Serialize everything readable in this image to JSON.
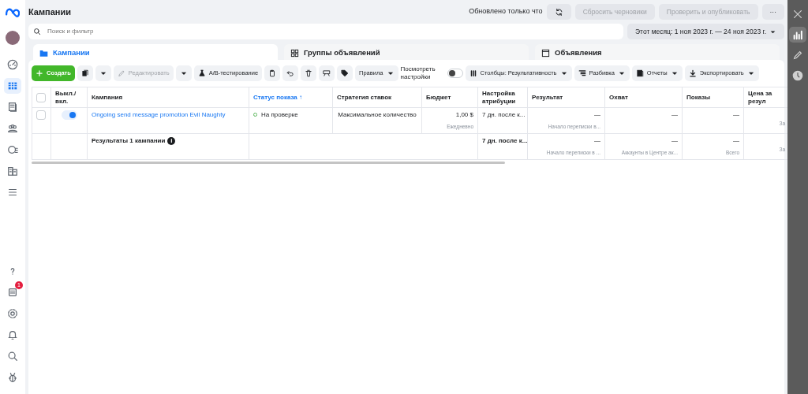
{
  "left_rail": {
    "top": [
      {
        "selected": false
      },
      {
        "selected": true
      },
      {
        "selected": false
      },
      {
        "selected": false
      },
      {
        "selected": false
      },
      {
        "selected": false
      },
      {
        "selected": false
      }
    ],
    "bottom": [
      {
        "selected": false
      },
      {
        "selected": false,
        "badge": "1"
      },
      {
        "selected": false
      },
      {
        "selected": false
      },
      {
        "selected": false
      },
      {
        "selected": false
      }
    ]
  },
  "header": {
    "title": "Кампании",
    "updated": "Обновлено только что",
    "buttons": [
      {
        "label": "Сбросить черновики",
        "disabled": true
      },
      {
        "label": "Проверить и опубликовать",
        "disabled": true
      }
    ],
    "more": "···"
  },
  "search": {
    "placeholder": "Поиск и фильтр"
  },
  "date_range": "Этот месяц: 1 ноя 2023 г. — 24 ноя 2023 г.",
  "tabs": [
    {
      "label": "Кампании",
      "selected": true
    },
    {
      "label": "Группы объявлений",
      "selected": false
    },
    {
      "label": "Объявления",
      "selected": false
    }
  ],
  "toolbar": {
    "create": "Создать",
    "edit": {
      "label": "Редактировать",
      "disabled": true
    },
    "ab_test": "A/B-тестирование",
    "rules": "Правила",
    "view_settings": {
      "label": "Посмотреть настройки",
      "on": false
    },
    "columns": "Столбцы: Результативность",
    "breakdown": "Разбивка",
    "reports": "Отчеты",
    "export": "Экспортировать"
  },
  "table": {
    "all_selected": false,
    "sort_mark": "↑",
    "columns": [
      {
        "label": "Выкл./ вкл.",
        "sorted": false
      },
      {
        "label": "Кампания",
        "sorted": false
      },
      {
        "label": "Статус показа",
        "sorted": true
      },
      {
        "label": "Стратегия ставок",
        "sorted": false
      },
      {
        "label": "Бюджет",
        "sorted": false
      },
      {
        "label": "Настройка атрибуции",
        "sorted": false
      },
      {
        "label": "Результат",
        "sorted": false
      },
      {
        "label": "Охват",
        "sorted": false
      },
      {
        "label": "Показы",
        "sorted": false
      },
      {
        "label": "Цена за резул",
        "sorted": false
      }
    ],
    "rows": [
      {
        "selected": false,
        "on": true,
        "campaign": "Ongoing send message promotion Evil Naughty",
        "status": "На проверке",
        "strategy": "Максимальное количество",
        "budget": "1,00 $",
        "budget_period": "Ежедневно",
        "attribution": "7 дн. после к...",
        "result": "—",
        "result_sub": "Начало переписки в...",
        "reach": "—",
        "impressions": "—",
        "cost_sub": "За"
      }
    ],
    "summary": {
      "label": "Результаты 1 кампании",
      "info": "i",
      "attribution": "7 дн. после к...",
      "result": "—",
      "result_sub": "Начало переписки в ...",
      "reach": "—",
      "reach_sub": "Аккаунты в Центре ак...",
      "impressions": "—",
      "impressions_sub": "Всего",
      "cost_sub": "За"
    }
  },
  "right_rail": [
    {
      "selected": false
    },
    {
      "selected": true
    },
    {
      "selected": false
    },
    {
      "selected": false
    }
  ]
}
